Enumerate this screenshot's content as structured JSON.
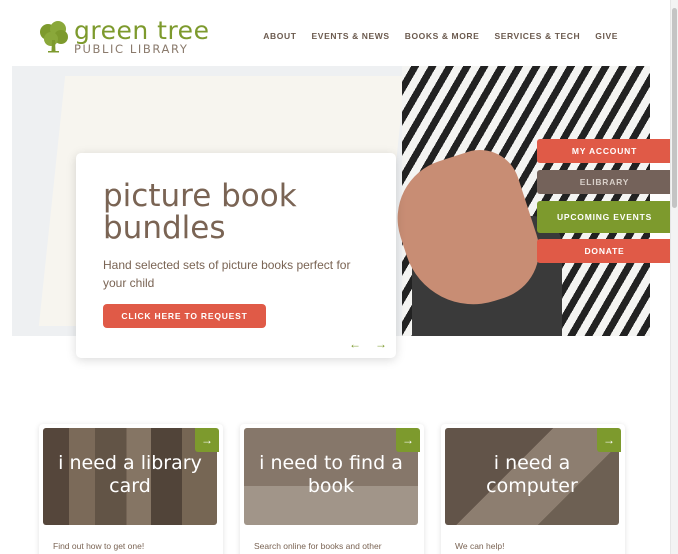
{
  "logo": {
    "title": "green tree",
    "subtitle": "PUBLIC LIBRARY"
  },
  "nav": [
    "ABOUT",
    "EVENTS & NEWS",
    "BOOKS & MORE",
    "SERVICES & TECH",
    "GIVE"
  ],
  "hero": {
    "title": "picture book bundles",
    "description": "Hand selected sets of picture books perfect for your child",
    "button": "CLICK HERE TO REQUEST",
    "prev": "←",
    "next": "→"
  },
  "quick_links": [
    "MY ACCOUNT",
    "ELIBRARY",
    "UPCOMING EVENTS",
    "DONATE"
  ],
  "cards": [
    {
      "title": "i need a library card",
      "desc": "Find out how to get one!"
    },
    {
      "title": "i need to find a book",
      "desc": "Search online for books and other"
    },
    {
      "title": "i need a computer",
      "desc": "We can help!"
    }
  ],
  "card_arrow": "→",
  "colors": {
    "brand_green": "#7d9a2d",
    "accent_red": "#e05a47",
    "brown": "#74625a",
    "text": "#6b5a4e"
  }
}
